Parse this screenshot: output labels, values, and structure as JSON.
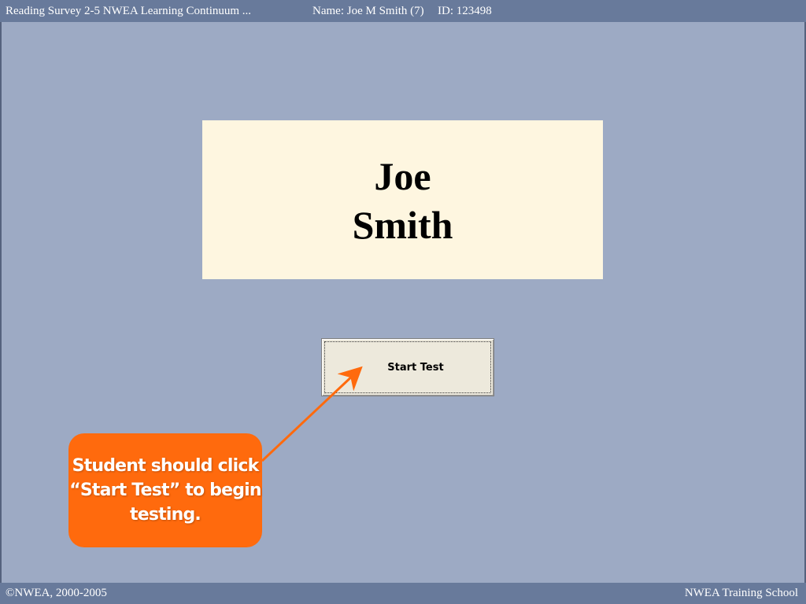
{
  "header": {
    "test_title": "Reading Survey 2-5 NWEA Learning Continuum ...",
    "student_name": "Name: Joe M Smith (7)",
    "student_id": "ID: 123498"
  },
  "name_card": {
    "first_name": "Joe",
    "last_name": "Smith"
  },
  "start_button": {
    "label": "Start Test"
  },
  "callout": {
    "lines": [
      "Student should click",
      "“Start Test” to begin",
      "testing."
    ],
    "color": "#ff6a0d"
  },
  "footer": {
    "copyright": "©NWEA, 2000-2005",
    "school": "NWEA Training School"
  },
  "colors": {
    "background": "#9daac4",
    "bar": "#687a9b",
    "card": "#fef6e0",
    "button": "#ede9dc",
    "accent": "#ff6a0d"
  }
}
